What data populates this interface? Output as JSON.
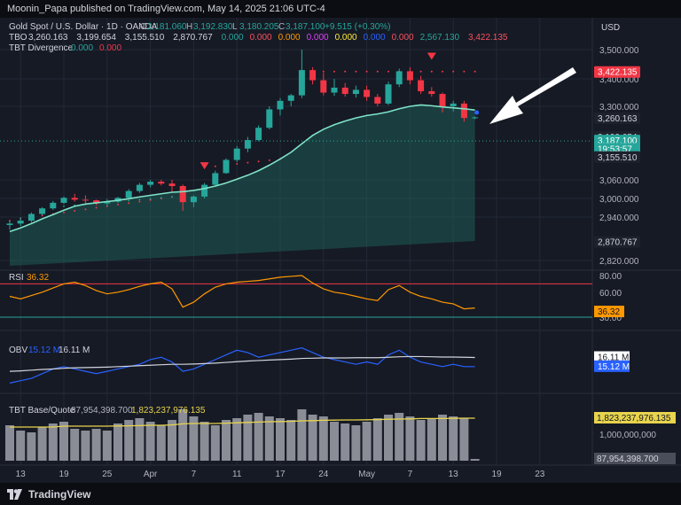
{
  "header": {
    "publisher": "Moonin_Papa published on TradingView.com, May 14, 2025 21:06 UTC-4"
  },
  "footer": {
    "brand": "TradingView"
  },
  "currency": "USD",
  "legend": {
    "symbol": "Gold Spot / U.S. Dollar · 1D · OANDA",
    "ohlc": [
      {
        "k": "O",
        "v": "3,181.060"
      },
      {
        "k": "H",
        "v": "3,192.830"
      },
      {
        "k": "L",
        "v": "3,180.205"
      },
      {
        "k": "C",
        "v": "3,187.100"
      }
    ],
    "change": "+9.515 (+0.30%)",
    "tbo": {
      "name": "TBO",
      "values": [
        {
          "v": "3,260.163",
          "color": "#d1d4dc"
        },
        {
          "v": "3,199.654",
          "color": "#d1d4dc"
        },
        {
          "v": "3,155.510",
          "color": "#d1d4dc"
        },
        {
          "v": "2,870.767",
          "color": "#d1d4dc"
        },
        {
          "v": "0.000",
          "color": "#26a69a"
        },
        {
          "v": "0.000",
          "color": "#f7525f"
        },
        {
          "v": "0.000",
          "color": "#ff9800"
        },
        {
          "v": "0.000",
          "color": "#e040fb"
        },
        {
          "v": "0.000",
          "color": "#ffeb3b"
        },
        {
          "v": "0.000",
          "color": "#2962ff"
        },
        {
          "v": "0.000",
          "color": "#f7525f"
        },
        {
          "v": "2,567.130",
          "color": "#26a69a"
        },
        {
          "v": "3,422.135",
          "color": "#f7525f"
        }
      ]
    },
    "divergence": {
      "name": "TBT Divergence",
      "v1": "0.000",
      "v2": "0.000"
    }
  },
  "colors": {
    "bg": "#161a25",
    "up": "#26a69a",
    "down": "#f23645",
    "ma": "#7fe3c8",
    "rsi": "#ff9800",
    "obv": "#2962ff",
    "obv_ma": "#d1d4dc",
    "vol": "#8a8d96",
    "vol_ma": "#e8d44d",
    "grid": "#232838"
  },
  "chart_data": {
    "type": "candlestick",
    "y_ticks": [
      "3,500.000",
      "3,400.000",
      "3,300.000",
      "3,060.000",
      "3,000.000",
      "2,940.000",
      "2,820.000"
    ],
    "y_tick_values": [
      3500,
      3400,
      3300,
      3060,
      3000,
      2940,
      2820
    ],
    "x_ticks": [
      "13",
      "19",
      "25",
      "Apr",
      "7",
      "11",
      "17",
      "24",
      "May",
      "7",
      "13",
      "19",
      "23"
    ],
    "x_tick_index": [
      1,
      5,
      9,
      13,
      17,
      21,
      25,
      29,
      33,
      37,
      41,
      45,
      49
    ],
    "price_labels": [
      {
        "text": "3,422.135",
        "value": 3422,
        "bg": "#f23645",
        "fg": "#ffffff"
      },
      {
        "text": "3,260.163",
        "value": 3260,
        "bg": "#1e222d",
        "fg": "#d1d4dc"
      },
      {
        "text": "3,199.654",
        "value": 3199,
        "bg": "#1e222d",
        "fg": "#d1d4dc"
      },
      {
        "text": "3,187.100",
        "value": 3187,
        "bg": "#26a69a",
        "fg": "#ffffff"
      },
      {
        "text": "19:53:57",
        "value": 3160,
        "bg": "#26a69a",
        "fg": "#ffffff"
      },
      {
        "text": "3,155.510",
        "value": 3133,
        "bg": "#1e222d",
        "fg": "#d1d4dc"
      },
      {
        "text": "2,870.767",
        "value": 2870,
        "bg": "#1e222d",
        "fg": "#d1d4dc"
      }
    ],
    "ohlc": [
      [
        2918,
        2930,
        2905,
        2922
      ],
      [
        2922,
        2940,
        2915,
        2930
      ],
      [
        2930,
        2955,
        2925,
        2950
      ],
      [
        2950,
        2972,
        2946,
        2968
      ],
      [
        2968,
        2992,
        2963,
        2986
      ],
      [
        2986,
        3006,
        2982,
        3002
      ],
      [
        3002,
        3015,
        2990,
        2996
      ],
      [
        2996,
        3010,
        2985,
        2994
      ],
      [
        2994,
        2996,
        2978,
        2984
      ],
      [
        2984,
        2998,
        2976,
        2990
      ],
      [
        2990,
        3005,
        2986,
        3002
      ],
      [
        3002,
        3030,
        2998,
        3024
      ],
      [
        3024,
        3050,
        3018,
        3044
      ],
      [
        3044,
        3060,
        3036,
        3054
      ],
      [
        3054,
        3060,
        3042,
        3048
      ],
      [
        3048,
        3060,
        3020,
        3040
      ],
      [
        3040,
        3045,
        2960,
        2988
      ],
      [
        2988,
        3010,
        2972,
        3006
      ],
      [
        3006,
        3050,
        3000,
        3044
      ],
      [
        3044,
        3090,
        3040,
        3082
      ],
      [
        3082,
        3130,
        3080,
        3125
      ],
      [
        3125,
        3170,
        3118,
        3162
      ],
      [
        3162,
        3200,
        3150,
        3190
      ],
      [
        3190,
        3238,
        3186,
        3230
      ],
      [
        3230,
        3300,
        3225,
        3290
      ],
      [
        3290,
        3330,
        3270,
        3320
      ],
      [
        3320,
        3345,
        3300,
        3340
      ],
      [
        3340,
        3500,
        3330,
        3430
      ],
      [
        3430,
        3440,
        3380,
        3395
      ],
      [
        3395,
        3420,
        3340,
        3350
      ],
      [
        3350,
        3400,
        3338,
        3368
      ],
      [
        3368,
        3385,
        3335,
        3345
      ],
      [
        3345,
        3375,
        3332,
        3360
      ],
      [
        3360,
        3375,
        3320,
        3334
      ],
      [
        3334,
        3345,
        3300,
        3310
      ],
      [
        3310,
        3390,
        3305,
        3380
      ],
      [
        3380,
        3435,
        3370,
        3426
      ],
      [
        3426,
        3440,
        3380,
        3395
      ],
      [
        3395,
        3410,
        3345,
        3355
      ],
      [
        3355,
        3370,
        3335,
        3345
      ],
      [
        3345,
        3350,
        3280,
        3300
      ],
      [
        3300,
        3320,
        3283,
        3310
      ],
      [
        3310,
        3320,
        3250,
        3262
      ],
      [
        3262,
        3267,
        3258,
        3264
      ]
    ],
    "ma": [
      2900,
      2910,
      2922,
      2935,
      2948,
      2962,
      2975,
      2982,
      2986,
      2990,
      2994,
      2999,
      3005,
      3010,
      3015,
      3020,
      3022,
      3026,
      3032,
      3040,
      3050,
      3062,
      3075,
      3090,
      3108,
      3128,
      3150,
      3178,
      3205,
      3225,
      3240,
      3252,
      3262,
      3270,
      3275,
      3282,
      3292,
      3300,
      3305,
      3302,
      3298,
      3295,
      3292,
      3288
    ],
    "rsi": [
      55,
      52,
      56,
      60,
      65,
      70,
      72,
      68,
      62,
      58,
      60,
      63,
      67,
      70,
      72,
      64,
      42,
      48,
      58,
      66,
      70,
      72,
      73,
      74,
      76,
      78,
      79,
      80,
      71,
      64,
      60,
      58,
      55,
      52,
      50,
      63,
      68,
      60,
      55,
      52,
      48,
      46,
      40,
      41
    ],
    "rsi_ticks": [
      "80.00",
      "60.00",
      "30.00"
    ],
    "rsi_label": "RSI",
    "rsi_value": "36.32",
    "obv": [
      5,
      6,
      7,
      9,
      11,
      12,
      11,
      10,
      9,
      10,
      11,
      12,
      13,
      15,
      16,
      14,
      10,
      11,
      13,
      15,
      17,
      19,
      18,
      16,
      17,
      18,
      19,
      20,
      18,
      16,
      15,
      14,
      13,
      14,
      13,
      17,
      19,
      16,
      14,
      13,
      12,
      13,
      12,
      12
    ],
    "obv_ma": [
      10,
      10.2,
      10.5,
      10.8,
      11,
      11.3,
      11.5,
      11.6,
      11.7,
      11.8,
      12,
      12.2,
      12.4,
      12.6,
      12.8,
      13,
      13,
      13.1,
      13.3,
      13.5,
      13.8,
      14.1,
      14.4,
      14.6,
      14.8,
      15,
      15.2,
      15.5,
      15.6,
      15.7,
      15.7,
      15.7,
      15.8,
      15.8,
      15.8,
      16,
      16.2,
      16.3,
      16.3,
      16.2,
      16.1,
      16.1,
      16,
      15.9
    ],
    "obv_label": "OBV",
    "obv_value": "15.12 M",
    "obv_ma_value": "16.11 M",
    "obv_labels": [
      {
        "text": "16.11 M",
        "bg": "#ffffff",
        "fg": "#131722",
        "value": 15.9
      },
      {
        "text": "15.12 M",
        "bg": "#2962ff",
        "fg": "#ffffff",
        "value": 12
      }
    ],
    "vol": [
      2.0,
      1.7,
      1.6,
      1.9,
      2.1,
      2.2,
      1.8,
      1.7,
      1.8,
      1.7,
      2.1,
      2.3,
      2.4,
      2.2,
      2.0,
      2.3,
      2.9,
      2.5,
      2.2,
      2.0,
      2.3,
      2.4,
      2.6,
      2.7,
      2.5,
      2.4,
      2.3,
      2.9,
      2.6,
      2.5,
      2.2,
      2.1,
      2.0,
      2.2,
      2.4,
      2.6,
      2.7,
      2.5,
      2.3,
      2.4,
      2.6,
      2.5,
      2.4,
      0.1
    ],
    "vol_ma": [
      1.9,
      1.9,
      1.9,
      1.9,
      1.9,
      1.95,
      1.95,
      1.95,
      1.95,
      1.95,
      1.96,
      1.97,
      1.98,
      2.0,
      2.0,
      2.02,
      2.08,
      2.1,
      2.1,
      2.1,
      2.12,
      2.14,
      2.16,
      2.18,
      2.2,
      2.21,
      2.22,
      2.25,
      2.26,
      2.28,
      2.29,
      2.3,
      2.3,
      2.31,
      2.32,
      2.34,
      2.35,
      2.36,
      2.38,
      2.38,
      2.38,
      2.39,
      2.4,
      2.4
    ],
    "vol_label": "TBT Base/Quote",
    "vol_values": [
      "87,954,398.700",
      "1,823,237,976.135"
    ],
    "vol_tick": "1,000,000,000",
    "vol_labels": [
      {
        "text": "1,823,237,976.135",
        "bg": "#e8d44d",
        "fg": "#131722",
        "value": 2.4
      },
      {
        "text": "87,954,398.700",
        "bg": "#4a4e5a",
        "fg": "#d1d4dc",
        "value": 0.1
      }
    ]
  }
}
